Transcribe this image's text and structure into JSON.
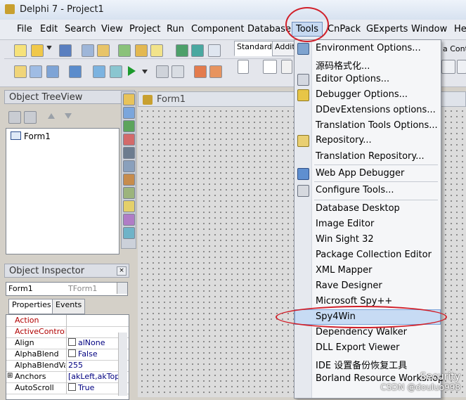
{
  "window": {
    "title": "Delphi 7 - Project1"
  },
  "menubar": {
    "items": [
      "File",
      "Edit",
      "Search",
      "View",
      "Project",
      "Run",
      "Component",
      "Database",
      "Tools",
      "CnPack",
      "GExperts",
      "Window",
      "He"
    ]
  },
  "palette": {
    "tabs": [
      "Standard",
      "Addit"
    ],
    "truncated_label": "a Contr"
  },
  "treeview": {
    "title": "Object TreeView",
    "root_item": "Form1"
  },
  "inspector": {
    "title": "Object Inspector",
    "object_name": "Form1",
    "object_type": "TForm1",
    "tabs": [
      "Properties",
      "Events"
    ],
    "rows": [
      {
        "name": "Action",
        "value": "",
        "kind": "event"
      },
      {
        "name": "ActiveControl",
        "value": "",
        "kind": "event"
      },
      {
        "name": "Align",
        "value": "alNone",
        "kind": "prop"
      },
      {
        "name": "AlphaBlend",
        "value": "False",
        "kind": "prop"
      },
      {
        "name": "AlphaBlendValu",
        "value": "255",
        "kind": "prop"
      },
      {
        "name": "Anchors",
        "value": "[akLeft,akTop",
        "kind": "prop"
      },
      {
        "name": "AutoScroll",
        "value": "True",
        "kind": "prop"
      }
    ]
  },
  "form": {
    "title": "Form1"
  },
  "tools_menu": {
    "items": [
      "Environment Options...",
      "源码格式化...",
      "Editor Options...",
      "Debugger Options...",
      "DDevExtensions options...",
      "Translation Tools Options...",
      "Repository...",
      "Translation Repository...",
      "Web App Debugger",
      "Configure Tools...",
      "Database Desktop",
      "Image Editor",
      "Win Sight 32",
      "Package Collection Editor",
      "XML Mapper",
      "Rave Designer",
      "Microsoft Spy++",
      "Spy4Win",
      "Dependency Walker",
      "DLL Export Viewer",
      "IDE 设置备份恢复工具",
      "Borland Resource Workshop"
    ],
    "highlighted": "Spy4Win"
  },
  "watermark": {
    "line1": "Security",
    "line2": "CSDN @douluo998"
  },
  "colors": {
    "annotation_red": "#d1202a",
    "highlight": "#c7dbf4"
  }
}
